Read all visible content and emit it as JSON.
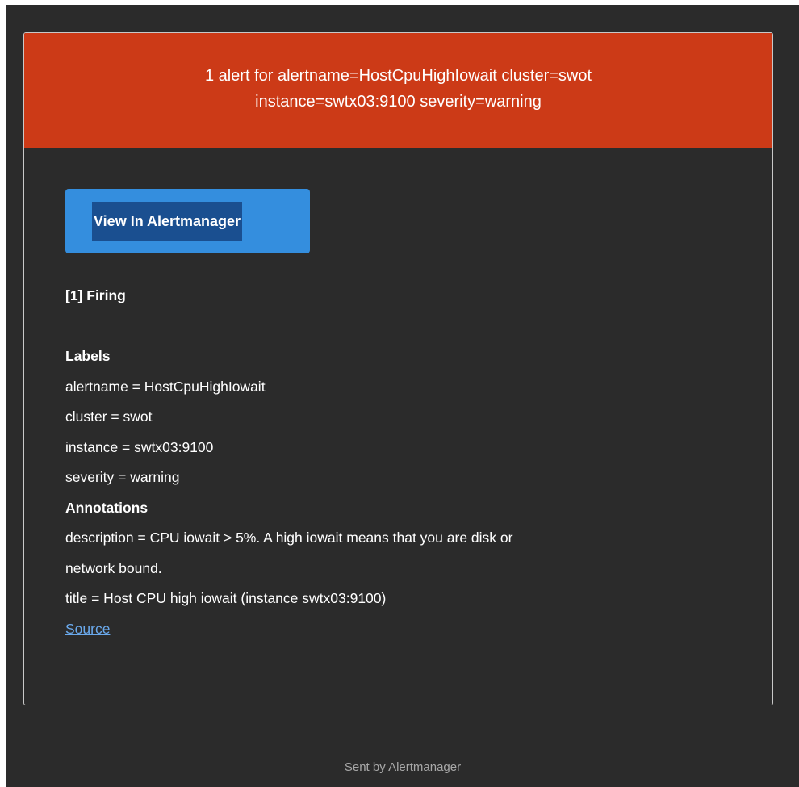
{
  "header": {
    "line1": "1 alert for alertname=HostCpuHighIowait cluster=swot",
    "line2": "instance=swtx03:9100 severity=warning"
  },
  "button": {
    "label": "View In Alertmanager"
  },
  "firing": "[1] Firing",
  "labels": {
    "heading": "Labels",
    "items": [
      "alertname = HostCpuHighIowait",
      "cluster = swot",
      "instance = swtx03:9100",
      "severity = warning"
    ]
  },
  "annotations": {
    "heading": "Annotations",
    "description_line1": "description = CPU iowait > 5%. A high iowait means that you are disk or",
    "description_line2": "network bound.",
    "title": "title = Host CPU high iowait (instance swtx03:9100)"
  },
  "source_link": "Source",
  "footer": {
    "text": "Sent by Alertmanager"
  },
  "colors": {
    "background": "#2b2b2b",
    "header": "#cc3a17",
    "button": "#348ede",
    "link": "#6aa9ec"
  }
}
